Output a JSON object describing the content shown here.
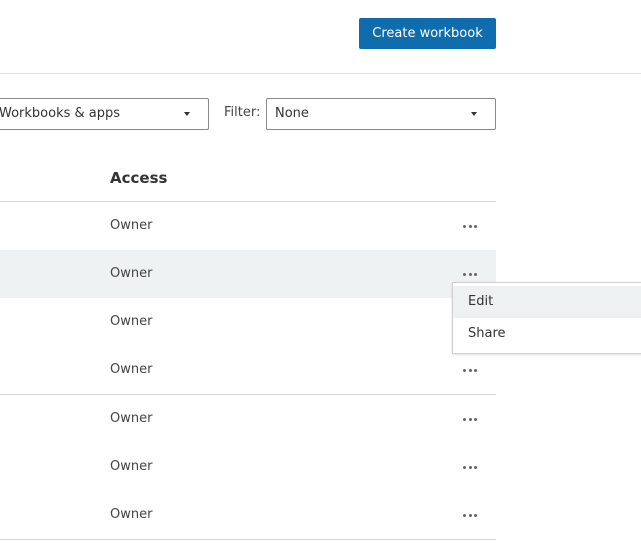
{
  "header": {
    "create_button": "Create workbook"
  },
  "toolbar": {
    "type_select_value": "Workbooks & apps",
    "filter_label": "Filter:",
    "filter_select_value": "None"
  },
  "table": {
    "columns": {
      "access": "Access"
    },
    "rows": [
      {
        "access": "Owner"
      },
      {
        "access": "Owner"
      },
      {
        "access": "Owner"
      },
      {
        "access": "Owner"
      },
      {
        "access": "Owner"
      },
      {
        "access": "Owner"
      },
      {
        "access": "Owner"
      }
    ]
  },
  "context_menu": {
    "items": [
      {
        "label": "Edit"
      },
      {
        "label": "Share"
      }
    ]
  },
  "icons": {
    "more": "more-horizontal-icon",
    "caret": "caret-down-icon"
  },
  "colors": {
    "primary": "#0f6cad",
    "row_highlight": "#eff2f2"
  }
}
